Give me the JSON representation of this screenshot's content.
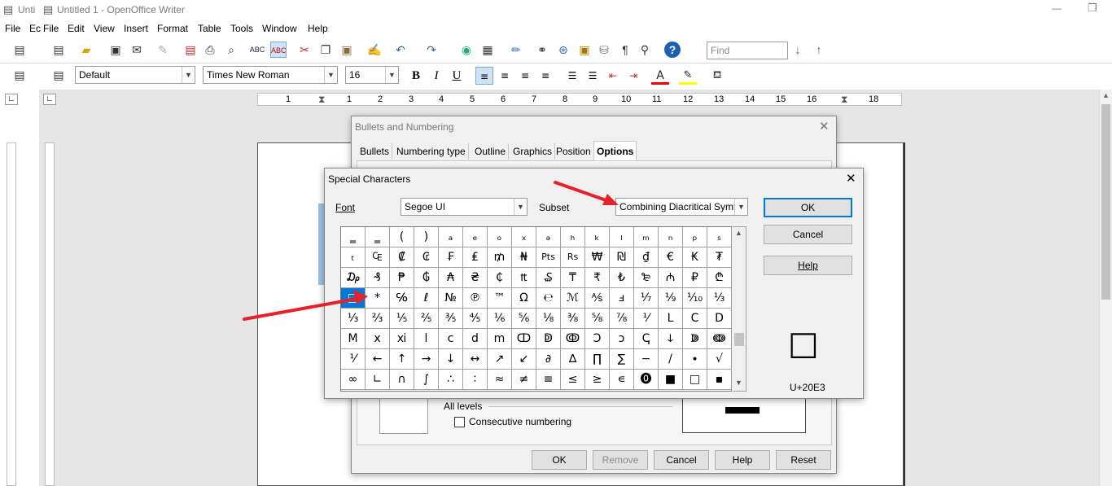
{
  "window": {
    "title_short": "Unti",
    "title": "Untitled 1 - OpenOffice Writer",
    "minimize": "—",
    "restore": "❐"
  },
  "menu": [
    "File",
    "Ec",
    "File",
    "Edit",
    "View",
    "Insert",
    "Format",
    "Table",
    "Tools",
    "Window",
    "Help"
  ],
  "toolbar": {
    "find_placeholder": "Find"
  },
  "format_toolbar": {
    "paragraph_style": "Default",
    "font_name": "Times New Roman",
    "font_size": "16",
    "bold": "B",
    "italic": "I",
    "underline": "U"
  },
  "ruler": {
    "numbers": [
      "1",
      "1",
      "2",
      "3",
      "4",
      "5",
      "6",
      "7",
      "8",
      "9",
      "10",
      "11",
      "12",
      "13",
      "14",
      "15",
      "16",
      "17",
      "18"
    ]
  },
  "bullets_dialog": {
    "title": "Bullets and Numbering",
    "tabs": [
      "Bullets",
      "Numbering type",
      "Outline",
      "Graphics",
      "Position",
      "Options"
    ],
    "active_tab": "Options",
    "all_levels": "All levels",
    "consecutive_numbering": "Consecutive numbering",
    "buttons": {
      "ok": "OK",
      "remove": "Remove",
      "cancel": "Cancel",
      "help": "Help",
      "reset": "Reset"
    }
  },
  "special_chars_dialog": {
    "title": "Special Characters",
    "font_label": "Font",
    "font_value": "Segoe UI",
    "subset_label": "Subset",
    "subset_value": "Combining Diacritical Symb",
    "buttons": {
      "ok": "OK",
      "cancel": "Cancel",
      "help": "Help"
    },
    "preview_char": "□",
    "unicode": "U+20E3",
    "grid": [
      [
        "‗",
        "‗",
        "(",
        ")",
        "ₐ",
        "ₑ",
        "ₒ",
        "ₓ",
        "ₔ",
        "ₕ",
        "ₖ",
        "ₗ",
        "ₘ",
        "ₙ",
        "ₚ",
        "ₛ"
      ],
      [
        "ₜ",
        "₠",
        "₡",
        "₢",
        "₣",
        "₤",
        "₥",
        "₦",
        "Pts",
        "Rs",
        "₩",
        "₪",
        "₫",
        "€",
        "₭",
        "₮"
      ],
      [
        "₯",
        "₰",
        "₱",
        "₲",
        "₳",
        "₴",
        "₵",
        "₶",
        "₷",
        "₸",
        "₹",
        "₺",
        "₻",
        "₼",
        "₽",
        "₾"
      ],
      [
        "□",
        "*",
        "℅",
        "ℓ",
        "№",
        "℗",
        "™",
        "Ω",
        "℮",
        "ℳ",
        "⅍",
        "ⅎ",
        "⅐",
        "⅑",
        "⅒",
        "⅓"
      ],
      [
        "⅓",
        "⅔",
        "⅕",
        "⅖",
        "⅗",
        "⅘",
        "⅙",
        "⅚",
        "⅛",
        "⅜",
        "⅝",
        "⅞",
        "⅟",
        "Ⅼ",
        "Ⅽ",
        "Ⅾ"
      ],
      [
        "Ⅿ",
        "ⅹ",
        "ⅺ",
        "ⅼ",
        "ⅽ",
        "ⅾ",
        "ⅿ",
        "ↀ",
        "ↁ",
        "ↂ",
        "Ↄ",
        "ↄ",
        "ↅ",
        "ↆ",
        "ↇ",
        "ↈ"
      ],
      [
        "⅟",
        "←",
        "↑",
        "→",
        "↓",
        "↔",
        "↗",
        "↙",
        "∂",
        "∆",
        "∏",
        "∑",
        "−",
        "∕",
        "∙",
        "√"
      ],
      [
        "∞",
        "∟",
        "∩",
        "∫",
        "∴",
        "∶",
        "≈",
        "≠",
        "≡",
        "≤",
        "≥",
        "∊",
        "⓿",
        "■",
        "□",
        "▪"
      ]
    ],
    "selected_cell": [
      3,
      0
    ]
  },
  "colors": {
    "accent": "#0078d7",
    "annotation_arrow": "#e8202a",
    "workspace": "#e6e6e6"
  }
}
